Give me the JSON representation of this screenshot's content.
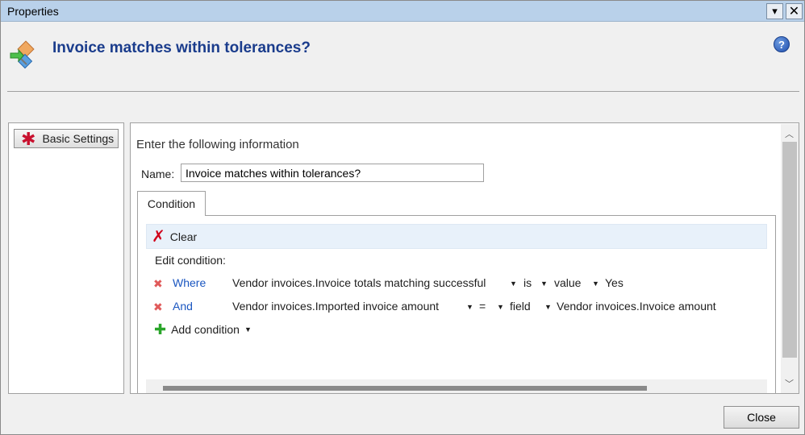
{
  "window": {
    "title": "Properties",
    "menu_glyph": "▾",
    "close_glyph": "✕"
  },
  "header": {
    "title": "Invoice matches within tolerances?",
    "help_glyph": "?"
  },
  "sidebar": {
    "basic_settings_label": "Basic Settings"
  },
  "main": {
    "instruction": "Enter the following information",
    "name_label": "Name:",
    "name_value": "Invoice matches within tolerances?",
    "tab_label": "Condition",
    "toolbar": {
      "clear_label": "Clear"
    },
    "edit_label": "Edit condition:",
    "conditions": [
      {
        "keyword": "Where",
        "field": "Vendor invoices.Invoice totals matching successful",
        "operator": "is",
        "type": "value",
        "value": "Yes"
      },
      {
        "keyword": "And",
        "field": "Vendor invoices.Imported invoice amount",
        "operator": "=",
        "type": "field",
        "value": "Vendor invoices.Invoice amount"
      }
    ],
    "add_condition_label": "Add condition"
  },
  "footer": {
    "close_label": "Close"
  },
  "colors": {
    "title_blue": "#1a3c8c",
    "keyword_blue": "#1a56c0",
    "delete_red": "#e05a5a",
    "add_green": "#2aa52a",
    "titlebar": "#b9d1ea"
  },
  "icons": [
    "workflow-decision-icon",
    "help-icon",
    "required-star-icon",
    "clear-icon",
    "delete-condition-icon",
    "add-condition-icon",
    "dropdown-arrow-icon"
  ]
}
